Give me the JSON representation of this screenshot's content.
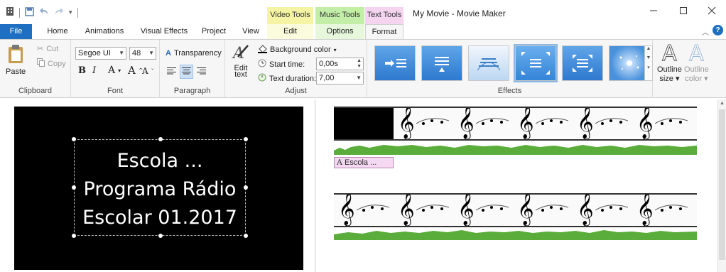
{
  "title_bar": {
    "window_title": "My Movie - Movie Maker",
    "context_groups": [
      "Video Tools",
      "Music Tools",
      "Text Tools"
    ],
    "window_buttons": [
      "minimize-icon",
      "maximize-icon",
      "close-icon"
    ]
  },
  "tabs": {
    "file": "File",
    "home": "Home",
    "animations": "Animations",
    "visual_effects": "Visual Effects",
    "project": "Project",
    "view": "View",
    "edit": "Edit",
    "options": "Options",
    "format": "Format"
  },
  "ribbon": {
    "clipboard": {
      "label": "Clipboard",
      "paste": "Paste",
      "cut": "Cut",
      "copy": "Copy"
    },
    "font": {
      "label": "Font",
      "family": "Segoe UI",
      "size": "48",
      "bold": "B",
      "italic": "I",
      "color": "A",
      "grow": "A",
      "shrink": "A"
    },
    "paragraph": {
      "label": "Paragraph",
      "transparency": "Transparency"
    },
    "adjust": {
      "label": "Adjust",
      "edit_text_line1": "Edit",
      "edit_text_line2": "text",
      "background_color": "Background color",
      "start_time_label": "Start time:",
      "start_time_value": "0,00s",
      "text_duration_label": "Text duration:",
      "text_duration_value": "7,00"
    },
    "effects": {
      "label": "Effects",
      "selected_index": 3
    },
    "outline": {
      "size_line1": "Outline",
      "size_line2": "size",
      "color_line1": "Outline",
      "color_line2": "color"
    }
  },
  "preview": {
    "line1": "Escola ...",
    "line2": "Programa Rádio",
    "line3": "Escolar 01.2017"
  },
  "storyboard": {
    "caption_label": "Escola ...",
    "caption_icon": "A"
  },
  "colors": {
    "file_tab": "#1e6fc2",
    "video_tools": "#f4f4a4",
    "music_tools": "#c3eea7",
    "text_tools": "#f5d4f0",
    "audio_wave": "#5aad3a",
    "effects_tile": "#3584d8"
  }
}
